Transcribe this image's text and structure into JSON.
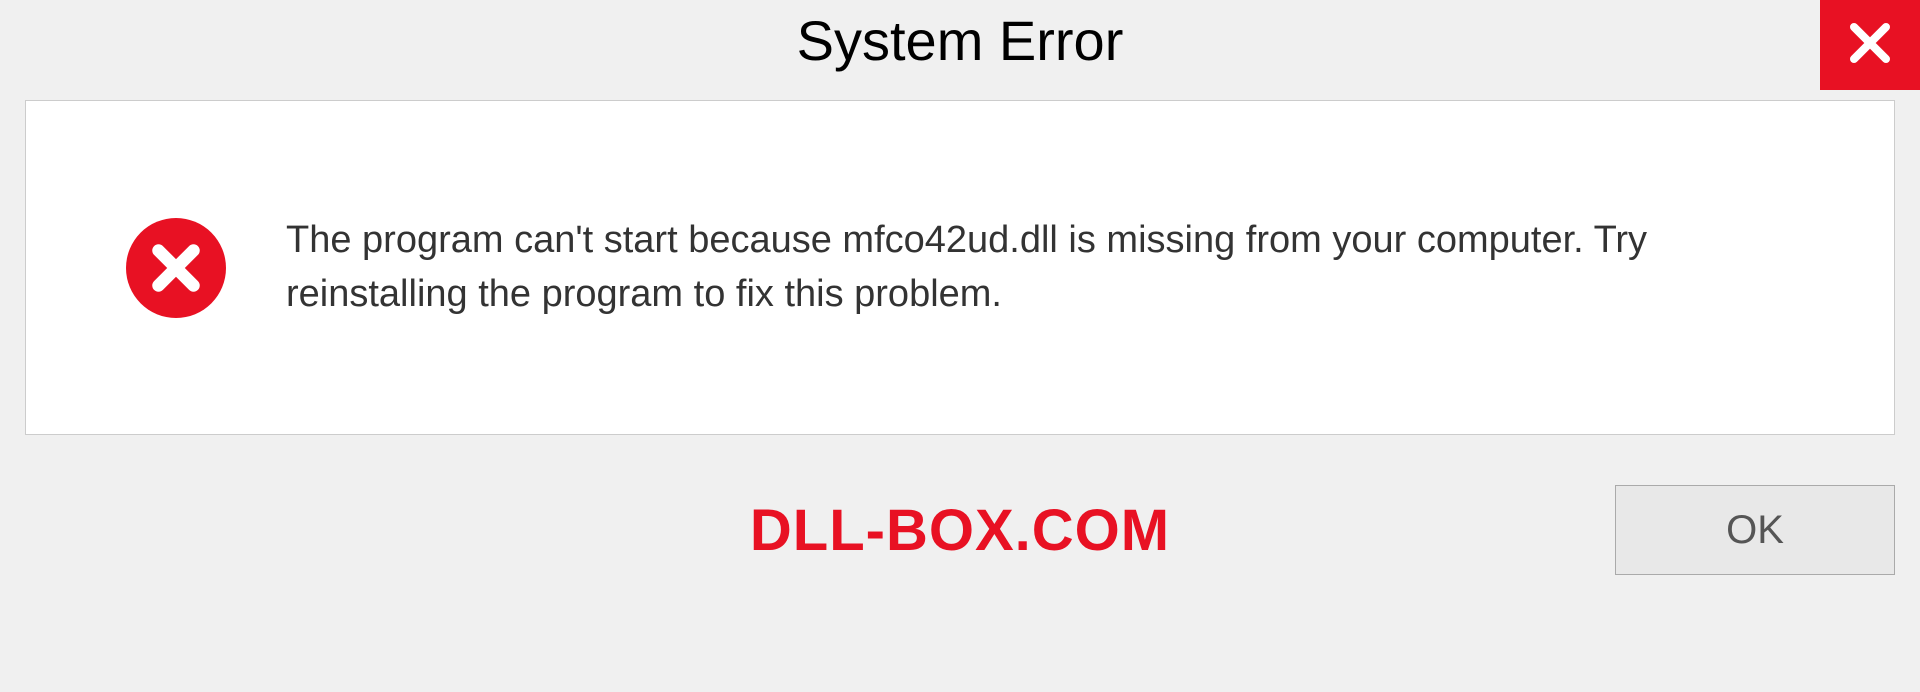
{
  "dialog": {
    "title": "System Error",
    "message": "The program can't start because mfco42ud.dll is missing from your computer. Try reinstalling the program to fix this problem.",
    "ok_label": "OK"
  },
  "watermark": "DLL-BOX.COM"
}
